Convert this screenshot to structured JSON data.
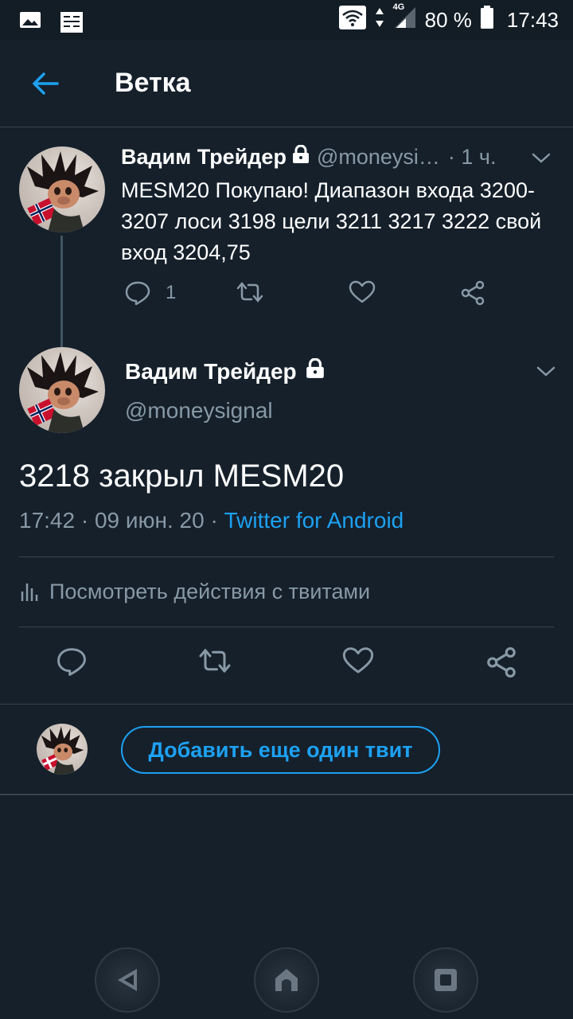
{
  "status_bar": {
    "battery": "80 %",
    "time": "17:43",
    "network": "4G"
  },
  "app_bar": {
    "title": "Ветка",
    "back_icon": "arrow-left-icon"
  },
  "parent_tweet": {
    "name": "Вадим Трейдер",
    "handle": "@moneysi…",
    "time": "· 1 ч.",
    "text": "MESM20 Покупаю! Диапазон входа 3200-3207 лоси 3198 цели 3211 3217 3222 свой вход 3204,75",
    "reply_count": "1"
  },
  "focus_tweet": {
    "name": "Вадим Трейдер",
    "handle": "@moneysignal",
    "text": "3218 закрыл MESM20",
    "timestamp": "17:42 · 09 июн. 20 · ",
    "source": "Twitter for Android",
    "activity_label": "Посмотреть действия с твитами"
  },
  "reply_bar": {
    "add_tweet_label": "Добавить еще один твит"
  },
  "colors": {
    "background": "#15202b",
    "accent": "#1da1f2",
    "secondary_text": "#8899a6",
    "divider": "#38444d"
  }
}
